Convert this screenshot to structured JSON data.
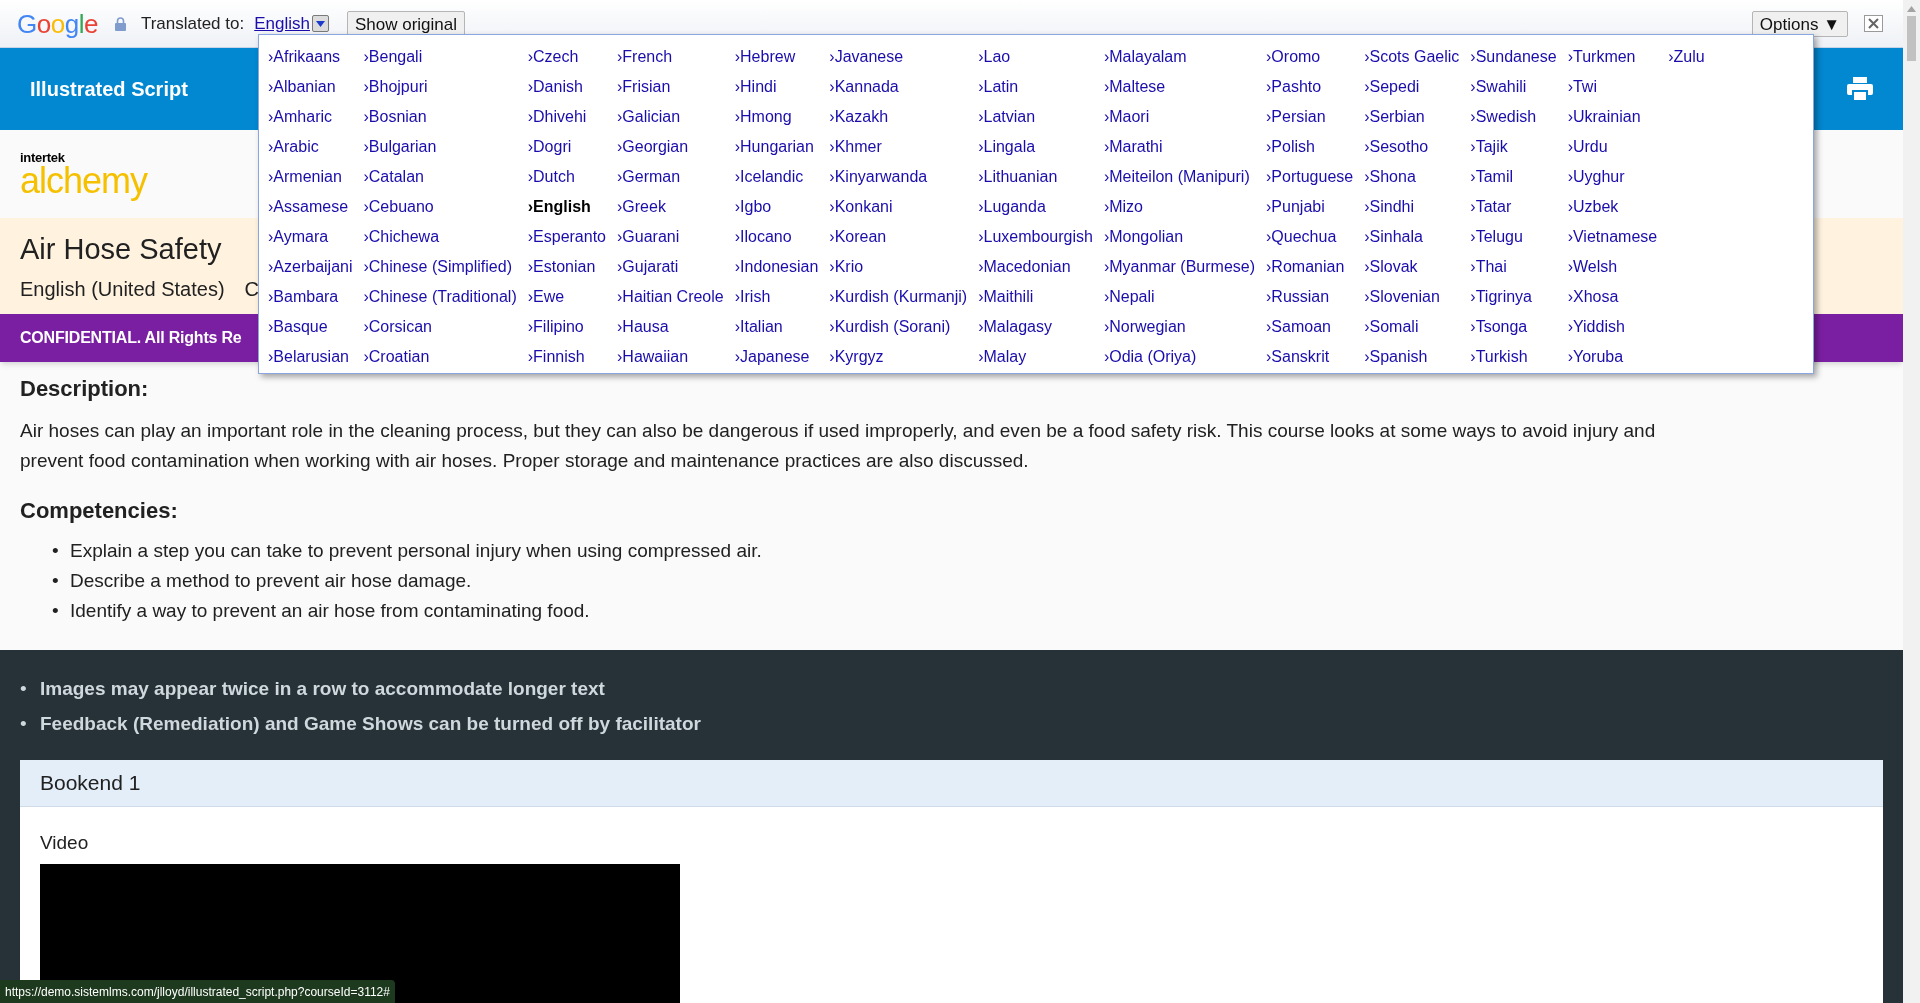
{
  "translate_bar": {
    "logo": "Google",
    "label": "Translated to:",
    "language": "English",
    "show_original": "Show original",
    "options": "Options ▼"
  },
  "language_menu": {
    "columns": [
      [
        {
          "label": "›Afrikaans",
          "selected": false
        },
        {
          "label": "›Albanian",
          "selected": false
        },
        {
          "label": "›Amharic",
          "selected": false
        },
        {
          "label": "›Arabic",
          "selected": false
        },
        {
          "label": "›Armenian",
          "selected": false
        },
        {
          "label": "›Assamese",
          "selected": false
        },
        {
          "label": "›Aymara",
          "selected": false
        },
        {
          "label": "›Azerbaijani",
          "selected": false
        },
        {
          "label": "›Bambara",
          "selected": false
        },
        {
          "label": "›Basque",
          "selected": false
        },
        {
          "label": "›Belarusian",
          "selected": false
        }
      ],
      [
        {
          "label": "›Bengali",
          "selected": false
        },
        {
          "label": "›Bhojpuri",
          "selected": false
        },
        {
          "label": "›Bosnian",
          "selected": false
        },
        {
          "label": "›Bulgarian",
          "selected": false
        },
        {
          "label": "›Catalan",
          "selected": false
        },
        {
          "label": "›Cebuano",
          "selected": false
        },
        {
          "label": "›Chichewa",
          "selected": false
        },
        {
          "label": "›Chinese (Simplified)",
          "selected": false
        },
        {
          "label": "›Chinese (Traditional)",
          "selected": false
        },
        {
          "label": "›Corsican",
          "selected": false
        },
        {
          "label": "›Croatian",
          "selected": false
        }
      ],
      [
        {
          "label": "›Czech",
          "selected": false
        },
        {
          "label": "›Danish",
          "selected": false
        },
        {
          "label": "›Dhivehi",
          "selected": false
        },
        {
          "label": "›Dogri",
          "selected": false
        },
        {
          "label": "›Dutch",
          "selected": false
        },
        {
          "label": "›English",
          "selected": true
        },
        {
          "label": "›Esperanto",
          "selected": false
        },
        {
          "label": "›Estonian",
          "selected": false
        },
        {
          "label": "›Ewe",
          "selected": false
        },
        {
          "label": "›Filipino",
          "selected": false
        },
        {
          "label": "›Finnish",
          "selected": false
        }
      ],
      [
        {
          "label": "›French",
          "selected": false
        },
        {
          "label": "›Frisian",
          "selected": false
        },
        {
          "label": "›Galician",
          "selected": false
        },
        {
          "label": "›Georgian",
          "selected": false
        },
        {
          "label": "›German",
          "selected": false
        },
        {
          "label": "›Greek",
          "selected": false
        },
        {
          "label": "›Guarani",
          "selected": false
        },
        {
          "label": "›Gujarati",
          "selected": false
        },
        {
          "label": "›Haitian Creole",
          "selected": false
        },
        {
          "label": "›Hausa",
          "selected": false
        },
        {
          "label": "›Hawaiian",
          "selected": false
        }
      ],
      [
        {
          "label": "›Hebrew",
          "selected": false
        },
        {
          "label": "›Hindi",
          "selected": false
        },
        {
          "label": "›Hmong",
          "selected": false
        },
        {
          "label": "›Hungarian",
          "selected": false
        },
        {
          "label": "›Icelandic",
          "selected": false
        },
        {
          "label": "›Igbo",
          "selected": false
        },
        {
          "label": "›Ilocano",
          "selected": false
        },
        {
          "label": "›Indonesian",
          "selected": false
        },
        {
          "label": "›Irish",
          "selected": false
        },
        {
          "label": "›Italian",
          "selected": false
        },
        {
          "label": "›Japanese",
          "selected": false
        }
      ],
      [
        {
          "label": "›Javanese",
          "selected": false
        },
        {
          "label": "›Kannada",
          "selected": false
        },
        {
          "label": "›Kazakh",
          "selected": false
        },
        {
          "label": "›Khmer",
          "selected": false
        },
        {
          "label": "›Kinyarwanda",
          "selected": false
        },
        {
          "label": "›Konkani",
          "selected": false
        },
        {
          "label": "›Korean",
          "selected": false
        },
        {
          "label": "›Krio",
          "selected": false
        },
        {
          "label": "›Kurdish (Kurmanji)",
          "selected": false
        },
        {
          "label": "›Kurdish (Sorani)",
          "selected": false
        },
        {
          "label": "›Kyrgyz",
          "selected": false
        }
      ],
      [
        {
          "label": "›Lao",
          "selected": false
        },
        {
          "label": "›Latin",
          "selected": false
        },
        {
          "label": "›Latvian",
          "selected": false
        },
        {
          "label": "›Lingala",
          "selected": false
        },
        {
          "label": "›Lithuanian",
          "selected": false
        },
        {
          "label": "›Luganda",
          "selected": false
        },
        {
          "label": "›Luxembourgish",
          "selected": false
        },
        {
          "label": "›Macedonian",
          "selected": false
        },
        {
          "label": "›Maithili",
          "selected": false
        },
        {
          "label": "›Malagasy",
          "selected": false
        },
        {
          "label": "›Malay",
          "selected": false
        }
      ],
      [
        {
          "label": "›Malayalam",
          "selected": false
        },
        {
          "label": "›Maltese",
          "selected": false
        },
        {
          "label": "›Maori",
          "selected": false
        },
        {
          "label": "›Marathi",
          "selected": false
        },
        {
          "label": "›Meiteilon (Manipuri)",
          "selected": false
        },
        {
          "label": "›Mizo",
          "selected": false
        },
        {
          "label": "›Mongolian",
          "selected": false
        },
        {
          "label": "›Myanmar (Burmese)",
          "selected": false
        },
        {
          "label": "›Nepali",
          "selected": false
        },
        {
          "label": "›Norwegian",
          "selected": false
        },
        {
          "label": "›Odia (Oriya)",
          "selected": false
        }
      ],
      [
        {
          "label": "›Oromo",
          "selected": false
        },
        {
          "label": "›Pashto",
          "selected": false
        },
        {
          "label": "›Persian",
          "selected": false
        },
        {
          "label": "›Polish",
          "selected": false
        },
        {
          "label": "›Portuguese",
          "selected": false
        },
        {
          "label": "›Punjabi",
          "selected": false
        },
        {
          "label": "›Quechua",
          "selected": false
        },
        {
          "label": "›Romanian",
          "selected": false
        },
        {
          "label": "›Russian",
          "selected": false
        },
        {
          "label": "›Samoan",
          "selected": false
        },
        {
          "label": "›Sanskrit",
          "selected": false
        }
      ],
      [
        {
          "label": "›Scots Gaelic",
          "selected": false
        },
        {
          "label": "›Sepedi",
          "selected": false
        },
        {
          "label": "›Serbian",
          "selected": false
        },
        {
          "label": "›Sesotho",
          "selected": false
        },
        {
          "label": "›Shona",
          "selected": false
        },
        {
          "label": "›Sindhi",
          "selected": false
        },
        {
          "label": "›Sinhala",
          "selected": false
        },
        {
          "label": "›Slovak",
          "selected": false
        },
        {
          "label": "›Slovenian",
          "selected": false
        },
        {
          "label": "›Somali",
          "selected": false
        },
        {
          "label": "›Spanish",
          "selected": false
        }
      ],
      [
        {
          "label": "›Sundanese",
          "selected": false
        },
        {
          "label": "›Swahili",
          "selected": false
        },
        {
          "label": "›Swedish",
          "selected": false
        },
        {
          "label": "›Tajik",
          "selected": false
        },
        {
          "label": "›Tamil",
          "selected": false
        },
        {
          "label": "›Tatar",
          "selected": false
        },
        {
          "label": "›Telugu",
          "selected": false
        },
        {
          "label": "›Thai",
          "selected": false
        },
        {
          "label": "›Tigrinya",
          "selected": false
        },
        {
          "label": "›Tsonga",
          "selected": false
        },
        {
          "label": "›Turkish",
          "selected": false
        }
      ],
      [
        {
          "label": "›Turkmen",
          "selected": false
        },
        {
          "label": "›Twi",
          "selected": false
        },
        {
          "label": "›Ukrainian",
          "selected": false
        },
        {
          "label": "›Urdu",
          "selected": false
        },
        {
          "label": "›Uyghur",
          "selected": false
        },
        {
          "label": "›Uzbek",
          "selected": false
        },
        {
          "label": "›Vietnamese",
          "selected": false
        },
        {
          "label": "›Welsh",
          "selected": false
        },
        {
          "label": "›Xhosa",
          "selected": false
        },
        {
          "label": "›Yiddish",
          "selected": false
        },
        {
          "label": "›Yoruba",
          "selected": false
        }
      ],
      [
        {
          "label": "›Zulu",
          "selected": false
        }
      ]
    ]
  },
  "header": {
    "title": "Illustrated Script"
  },
  "logo": {
    "top": "intertek",
    "bottom": "alchemy"
  },
  "course": {
    "title": "Air Hose Safety",
    "language": "English (United States)",
    "column_2": "C"
  },
  "banner": "CONFIDENTIAL. All Rights Re",
  "description": {
    "heading": "Description:",
    "text": "Air hoses can play an important role in the cleaning process, but they can also be dangerous if used improperly, and even be a food safety risk. This course looks at some ways to avoid injury and prevent food contamination when working with air hoses. Proper storage and maintenance practices are also discussed."
  },
  "competencies": {
    "heading": "Competencies:",
    "items": [
      {
        "bullet": "•",
        "text": "Explain a step you can take to prevent personal injury when using compressed air."
      },
      {
        "bullet": "•",
        "text": "Describe a method to prevent air hose damage."
      },
      {
        "bullet": "•",
        "text": "Identify a way to prevent an air hose from contaminating food."
      }
    ]
  },
  "notes": [
    {
      "bullet": "•",
      "text": "Images may appear twice in a row to accommodate longer text"
    },
    {
      "bullet": "•",
      "text": "Feedback (Remediation) and Game Shows can be turned off by facilitator"
    }
  ],
  "card": {
    "title": "Bookend 1",
    "label": "Video"
  },
  "status_url": "https://demo.sistemlms.com/jlloyd/illustrated_script.php?courseId=3112#"
}
